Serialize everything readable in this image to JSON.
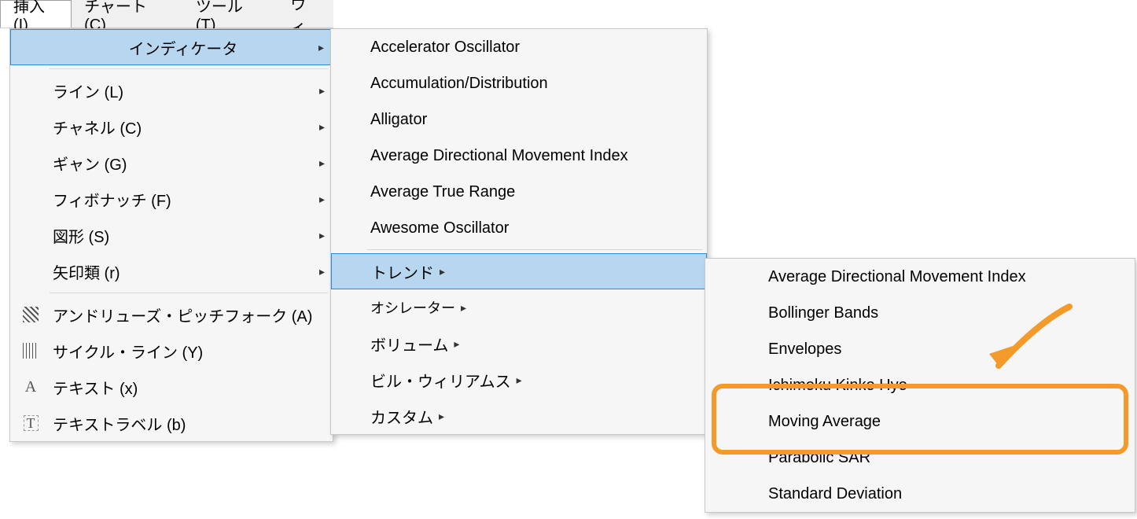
{
  "menubar": {
    "insert": "挿入(I)",
    "chart": "チャート (C)",
    "tools": "ツール (T)",
    "window_partial": "ウィ"
  },
  "menu1": {
    "indicators": "インディケータ",
    "line": "ライン (L)",
    "channel": "チャネル (C)",
    "gann": "ギャン (G)",
    "fibo": "フィボナッチ (F)",
    "shapes": "図形 (S)",
    "arrows": "矢印類 (r)",
    "pitchfork": "アンドリューズ・ピッチフォーク (A)",
    "cycle": "サイクル・ライン (Y)",
    "text": "テキスト (x)",
    "textlabel": "テキストラベル (b)"
  },
  "menu2": {
    "accelerator": "Accelerator Oscillator",
    "accum": "Accumulation/Distribution",
    "alligator": "Alligator",
    "admi": "Average Directional Movement Index",
    "atr": "Average True Range",
    "awesome": "Awesome Oscillator",
    "trend": "トレンド",
    "oscillator": "オシレーター",
    "volume": "ボリューム",
    "billwilliams": "ビル・ウィリアムス",
    "custom": "カスタム"
  },
  "menu3": {
    "admi": "Average Directional Movement Index",
    "bollinger": "Bollinger Bands",
    "envelopes": "Envelopes",
    "ichimoku": "Ichimoku Kinko Hyo",
    "ma": "Moving Average",
    "parabolic": "Parabolic SAR",
    "stddev": "Standard Deviation"
  },
  "arrow_glyph": "▸"
}
